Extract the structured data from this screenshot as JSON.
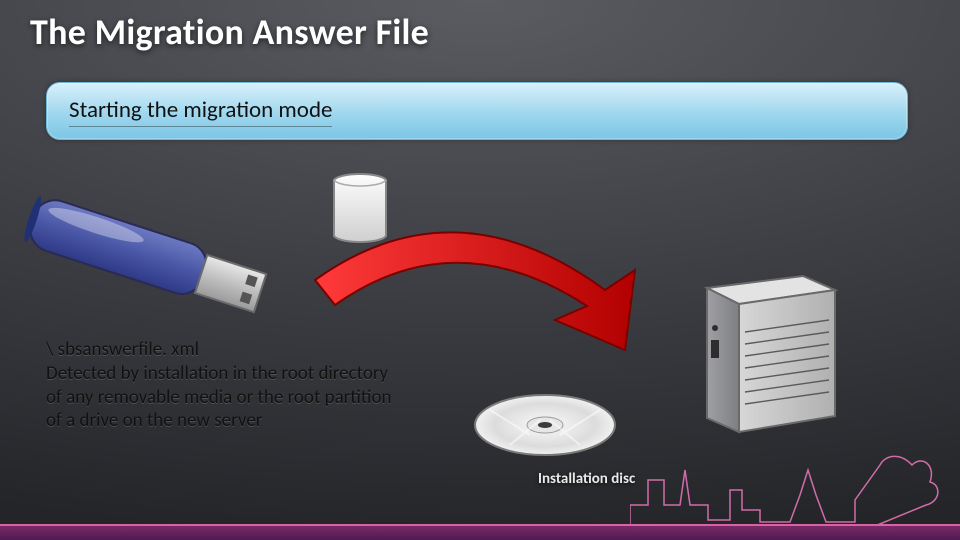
{
  "title": "The Migration Answer File",
  "banner_label": "Starting the migration mode",
  "file_path_line": "\\ sbsanswerfile. xml",
  "description_lines": [
    "Detected by installation in the root directory",
    "of any removable media or the root partition",
    "of a drive on the new server"
  ],
  "disc_caption": "Installation disc",
  "icons": {
    "usb": "usb-drive-icon",
    "paper": "document-icon",
    "arrow": "red-arrow-icon",
    "cd": "cd-disc-icon",
    "server": "server-tower-icon",
    "skyline": "city-skyline-silhouette"
  },
  "colors": {
    "arrow": "#d81a1a",
    "banner_top": "#d9f0fb",
    "banner_bottom": "#7cc6e6",
    "accent": "#d26ca8"
  }
}
